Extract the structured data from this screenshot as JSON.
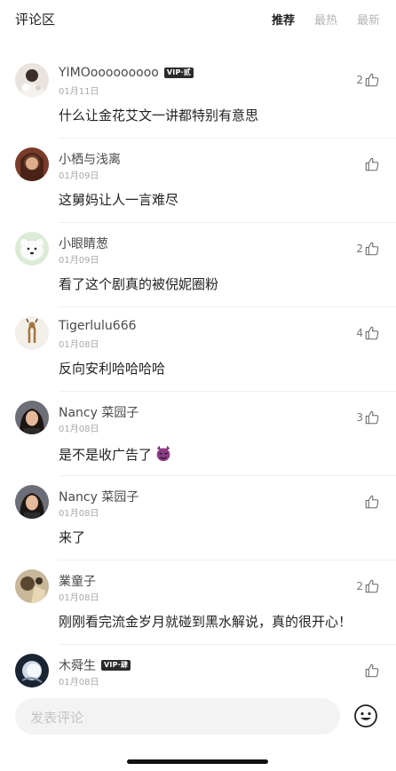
{
  "header": {
    "title": "评论区",
    "tabs": [
      {
        "label": "推荐",
        "active": true
      },
      {
        "label": "最热",
        "active": false
      },
      {
        "label": "最新",
        "active": false
      }
    ]
  },
  "comments": [
    {
      "name": "YIMOooooooooo",
      "vip": "VIP·贰",
      "date": "01月11日",
      "text": "什么让金花艾文一讲都特别有意思",
      "likes": "2"
    },
    {
      "name": "小栖与浅离",
      "vip": "",
      "date": "01月09日",
      "text": "这舅妈让人一言难尽",
      "likes": ""
    },
    {
      "name": "小眼睛葱",
      "vip": "",
      "date": "01月09日",
      "text": "看了这个剧真的被倪妮圈粉",
      "likes": "2"
    },
    {
      "name": "Tigerlulu666",
      "vip": "",
      "date": "01月08日",
      "text": "反向安利哈哈哈哈",
      "likes": "4"
    },
    {
      "name": "Nancy 菜园子",
      "vip": "",
      "date": "01月08日",
      "text": "是不是收广告了",
      "likes": "3"
    },
    {
      "name": "Nancy 菜园子",
      "vip": "",
      "date": "01月08日",
      "text": "来了",
      "likes": ""
    },
    {
      "name": "業童子",
      "vip": "",
      "date": "01月08日",
      "text": "刚刚看完流金岁月就碰到黑水解说，真的很开心！",
      "likes": "2"
    },
    {
      "name": "木舜生",
      "vip": "VIP·肆",
      "date": "01月08日",
      "text": "",
      "likes": ""
    }
  ],
  "footer": {
    "placeholder": "发表评论",
    "emoji_icon": "smiley-icon"
  },
  "colors": {
    "accent_text": "#222222",
    "muted_text": "#a8a8a8",
    "input_bg": "#f3f3f3",
    "vip_badge": "#2b2b2b"
  }
}
